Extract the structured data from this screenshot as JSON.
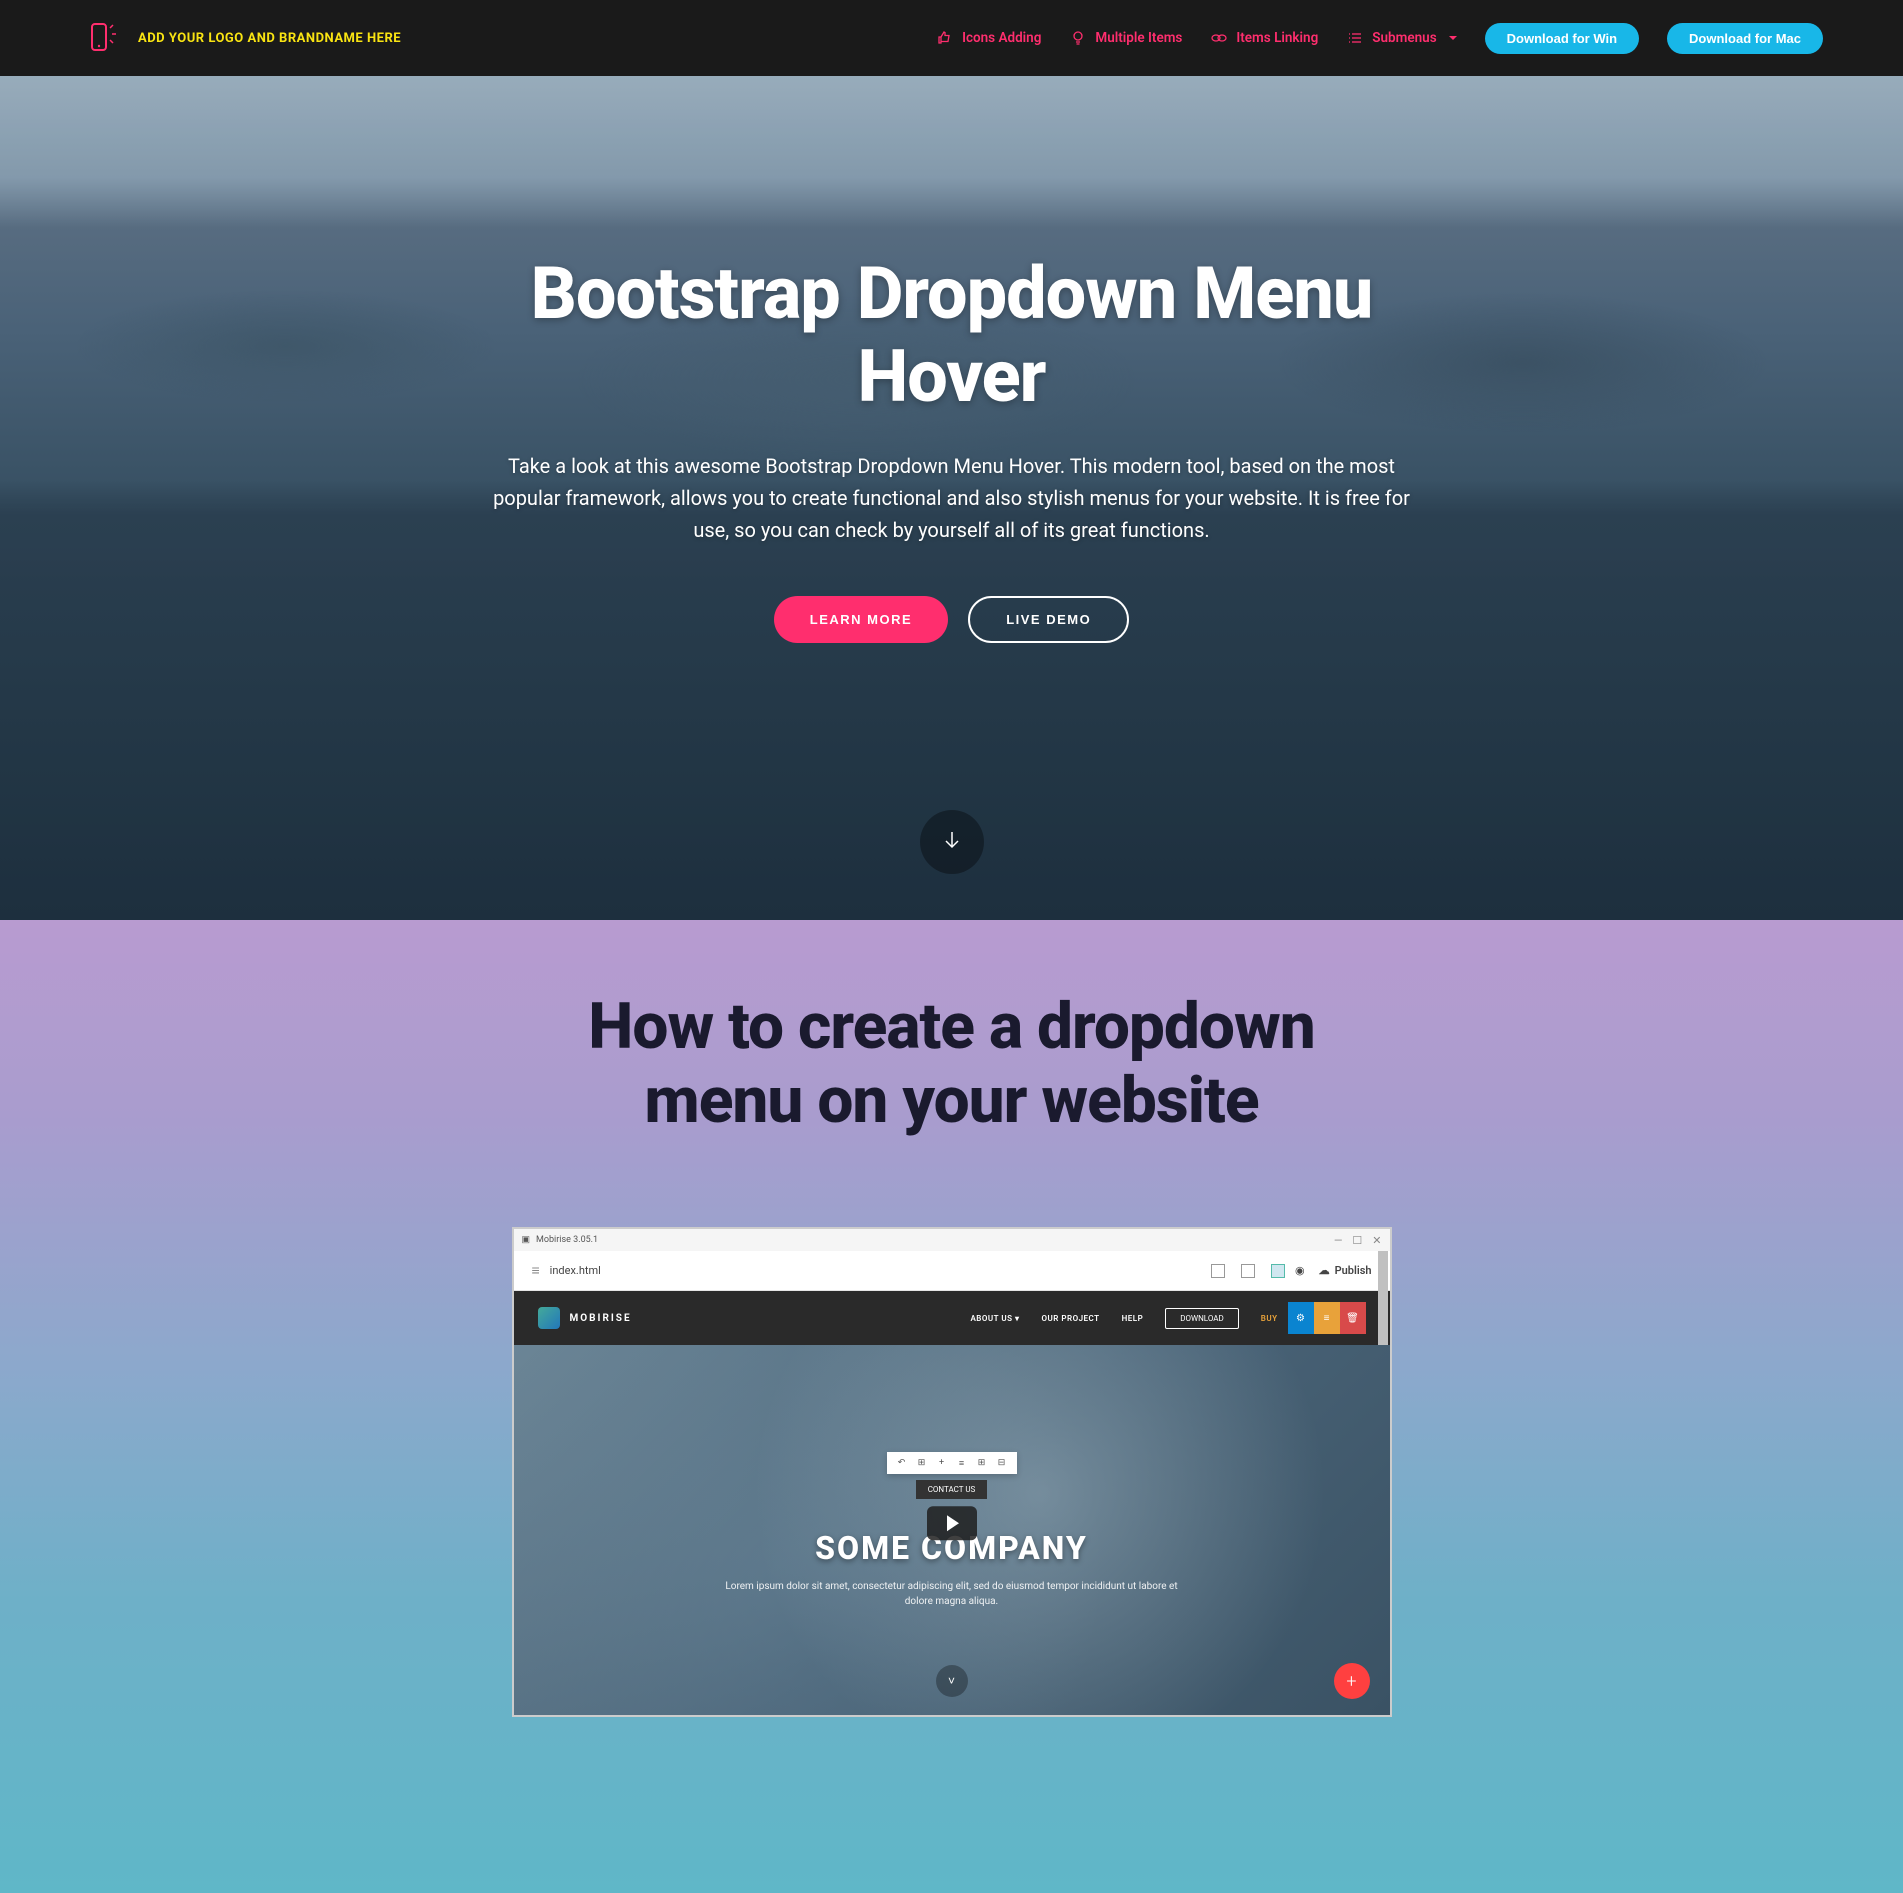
{
  "navbar": {
    "brand": "ADD YOUR LOGO AND BRANDNAME HERE",
    "items": [
      {
        "label": "Icons Adding"
      },
      {
        "label": "Multiple Items"
      },
      {
        "label": "Items Linking"
      },
      {
        "label": "Submenus"
      }
    ],
    "download_win": "Download for Win",
    "download_mac": "Download for Mac"
  },
  "hero": {
    "title": "Bootstrap Dropdown Menu Hover",
    "description": "Take a look at this awesome Bootstrap Dropdown Menu Hover. This modern tool, based on the most popular framework, allows you to create functional and also stylish menus for your website. It is free for use, so you can check by yourself all of its great functions.",
    "learn_more": "LEARN MORE",
    "live_demo": "LIVE DEMO"
  },
  "section2": {
    "title": "How to create a dropdown menu on your website"
  },
  "mobirise_app": {
    "window_title": "Mobirise 3.05.1",
    "page_name": "index.html",
    "publish": "Publish",
    "brand": "MOBIRISE",
    "nav": {
      "about": "ABOUT US",
      "project": "OUR PROJECT",
      "help": "HELP",
      "download": "DOWNLOAD",
      "buy": "BUY"
    },
    "tooltip": "CONTACT US",
    "hero_title": "SOME COMPANY",
    "hero_sub": "Lorem ipsum dolor sit amet, consectetur adipiscing elit, sed do eiusmod tempor incididunt ut labore et dolore magna aliqua."
  }
}
